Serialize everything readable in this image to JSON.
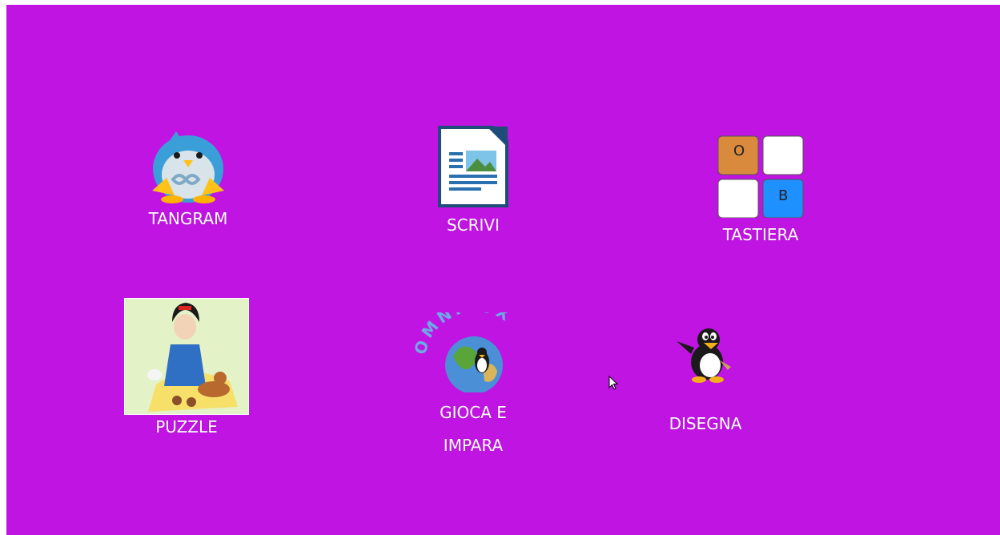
{
  "desktop": {
    "background_color": "#c014e2",
    "apps": [
      {
        "label": "TANGRAM",
        "icon": "penguin-tangram-icon"
      },
      {
        "label": "SCRIVI",
        "icon": "writer-document-icon"
      },
      {
        "label": "TASTIERA",
        "icon": "keyboard-keys-icon",
        "keys": [
          "O",
          "",
          "",
          "B"
        ]
      },
      {
        "label": "PUZZLE",
        "icon": "snow-white-puzzle-icon"
      },
      {
        "label": "GIOCA E",
        "label_line2": "IMPARA",
        "icon": "omnitux-globe-icon",
        "logo_text": "OMNITUX"
      },
      {
        "label": "DISEGNA",
        "icon": "tux-paint-penguin-icon"
      }
    ]
  },
  "colors": {
    "key_o": "#d98a3c",
    "key_b": "#1e90ff",
    "label_text": "#ffffff"
  }
}
